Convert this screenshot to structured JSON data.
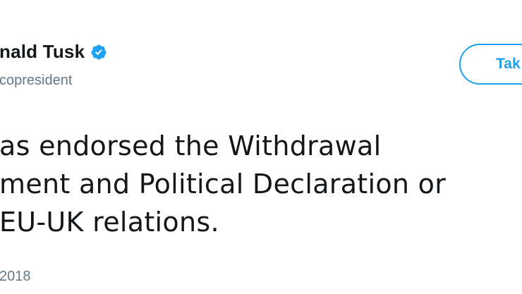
{
  "author": {
    "display_name": "nald Tusk",
    "handle": "copresident",
    "verified_icon": "verified-badge-icon",
    "verified_color": "#1da1f2"
  },
  "follow_button": {
    "label": "Tak"
  },
  "tweet": {
    "lines": [
      "as endorsed the Withdrawal",
      "ment and Political Declaration or",
      "EU-UK relations."
    ],
    "timestamp": "2018"
  },
  "colors": {
    "text": "#14171a",
    "secondary_text": "#657786",
    "accent": "#1da1f2",
    "background": "#ffffff"
  }
}
